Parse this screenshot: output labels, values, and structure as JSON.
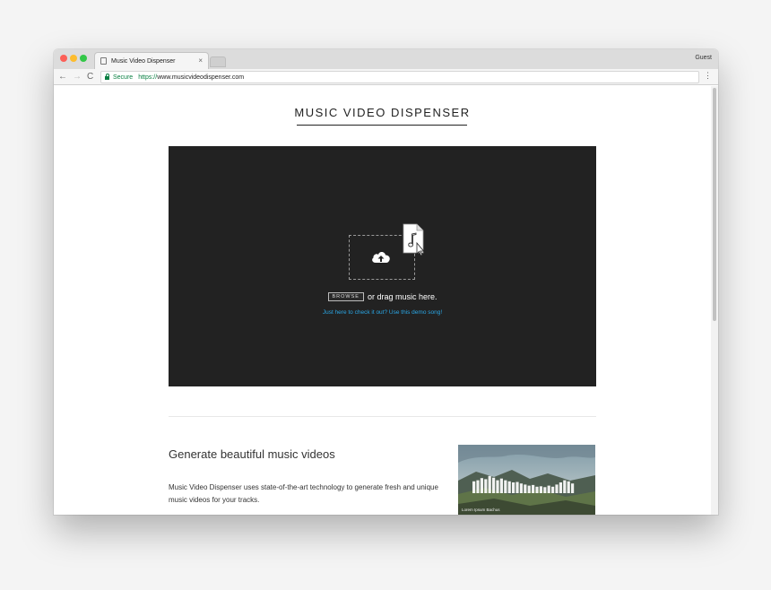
{
  "browser": {
    "tab_title": "Music Video Dispenser",
    "tab_close": "×",
    "profile": "Guest",
    "nav_back": "←",
    "nav_forward": "→",
    "nav_reload": "C",
    "secure_label": "Secure",
    "url_scheme": "https://",
    "url_host": "www.musicvideodispenser.com",
    "menu": "⋮"
  },
  "page": {
    "title": "MUSIC VIDEO DISPENSER",
    "dropzone": {
      "browse_label": "BROWSE",
      "drop_text": "or drag music here.",
      "demo_link": "Just here to check it out? Use this demo song!"
    },
    "feature": {
      "heading": "Generate beautiful music videos",
      "body": "Music Video Dispenser uses state-of-the-art technology to generate fresh and unique music videos for your tracks.",
      "image_caption": "Lorem Ipsum Bachus",
      "equalizer_levels": [
        0.55,
        0.6,
        0.7,
        0.65,
        0.8,
        0.72,
        0.6,
        0.68,
        0.6,
        0.55,
        0.5,
        0.52,
        0.45,
        0.4,
        0.35,
        0.38,
        0.3,
        0.32,
        0.28,
        0.35,
        0.3,
        0.4,
        0.5,
        0.6,
        0.55,
        0.45
      ]
    }
  },
  "colors": {
    "dropzone_bg": "#222222",
    "link": "#2aa7e6",
    "secure": "#0b8043"
  }
}
